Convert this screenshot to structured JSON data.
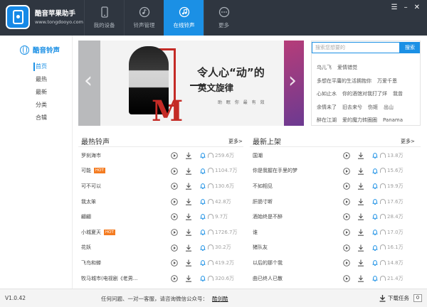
{
  "app": {
    "name": "酷音苹果助手",
    "site": "www.tongdooyo.com"
  },
  "nav": {
    "tabs": [
      {
        "label": "我的设备",
        "icon": "phone-icon",
        "active": false
      },
      {
        "label": "铃声管理",
        "icon": "ringtone-manage-icon",
        "active": false
      },
      {
        "label": "在线铃声",
        "icon": "music-note-icon",
        "active": true
      },
      {
        "label": "更多",
        "icon": "more-icon",
        "active": false
      }
    ]
  },
  "sidebar": {
    "title": "酷音铃声",
    "items": [
      {
        "label": "首页",
        "active": true
      },
      {
        "label": "最热",
        "active": false
      },
      {
        "label": "最新",
        "active": false
      },
      {
        "label": "分类",
        "active": false
      },
      {
        "label": "合辑",
        "active": false
      }
    ]
  },
  "banner": {
    "line1": "令人心“动”的",
    "line2": "英文旋律",
    "line3": "助 眠 你 最 有 效"
  },
  "search": {
    "placeholder": "搜索您想要的",
    "button": "搜索",
    "hot_rows": [
      [
        "乌儿飞",
        "爱情错觉"
      ],
      [
        "多想在平庸的生活拥抱你",
        "万爱千恩"
      ],
      [
        "心如止水",
        "你的酒馆对我打了烊",
        "我曾"
      ],
      [
        "余情未了",
        "旧去来兮",
        "伤姬",
        "出山"
      ],
      [
        "醉在江湖",
        "爱的魔力转圈圈",
        "Panama"
      ]
    ]
  },
  "hottest": {
    "title": "最热铃声",
    "more": "更多>",
    "rows": [
      {
        "name": "罗刹海市",
        "hot": false,
        "count": "259.6万"
      },
      {
        "name": "可能",
        "hot": true,
        "count": "1104.7万"
      },
      {
        "name": "可不可以",
        "hot": false,
        "count": "130.6万"
      },
      {
        "name": "我太笨",
        "hot": false,
        "count": "42.8万"
      },
      {
        "name": "翩翩",
        "hot": false,
        "count": "9.7万"
      },
      {
        "name": "小城夏天",
        "hot": true,
        "count": "1726.7万"
      },
      {
        "name": "花妖",
        "hot": false,
        "count": "30.2万"
      },
      {
        "name": "飞鸟和蝉",
        "hot": false,
        "count": "419.2万"
      },
      {
        "name": "牧马城市(电视剧《老男...",
        "hot": false,
        "count": "320.6万"
      }
    ]
  },
  "newest": {
    "title": "最新上架",
    "more": "更多>",
    "rows": [
      {
        "name": "国潮",
        "count": "13.8万"
      },
      {
        "name": "你是我握在手里的梦",
        "count": "15.6万"
      },
      {
        "name": "不如相见",
        "count": "19.9万"
      },
      {
        "name": "肝肠寸断",
        "count": "17.6万"
      },
      {
        "name": "酒始终是不醉",
        "count": "28.4万"
      },
      {
        "name": "谁",
        "count": "17.0万"
      },
      {
        "name": "猪队友",
        "count": "16.1万"
      },
      {
        "name": "以后的那个我",
        "count": "14.8万"
      },
      {
        "name": "曲已终人已散",
        "count": "21.4万"
      }
    ]
  },
  "footer": {
    "version": "V1.0.42",
    "help_text": "任何问题、一对一客服，请咨询微信公众号：",
    "help_link": "酷剑酷",
    "downloads_label": "下载任务",
    "downloads_count": "0"
  },
  "colors": {
    "accent": "#1b90e5",
    "topbar": "#2f3640",
    "hot_badge": "#f47b20",
    "banner_red": "#c42b26"
  }
}
